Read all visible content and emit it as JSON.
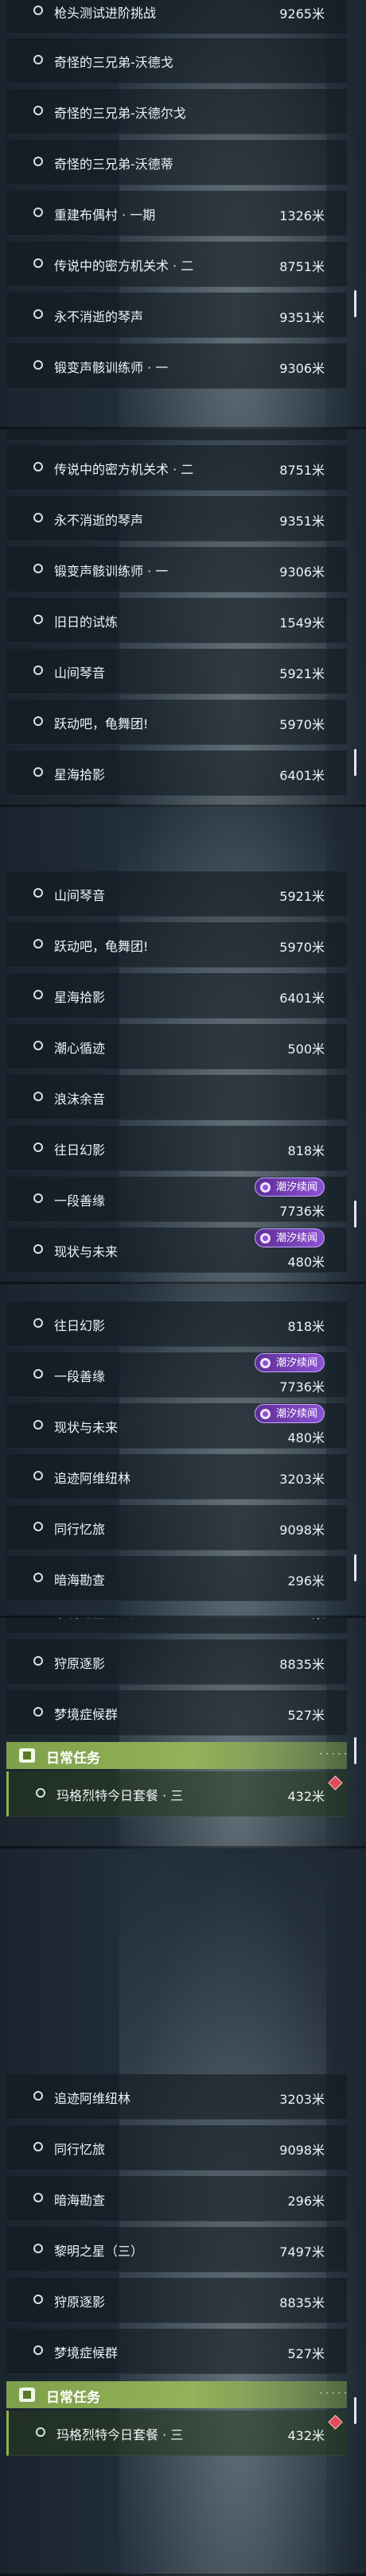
{
  "badge_label": "潮汐续闻",
  "daily": {
    "title": "日常任务",
    "count_dots": "· · · · ·"
  },
  "rows": {
    "r1": {
      "name": "枪头测试进阶挑战",
      "dist": "9265米"
    },
    "r2": {
      "name": "奇怪的三兄弟-沃德戈",
      "dist": ""
    },
    "r3": {
      "name": "奇怪的三兄弟-沃德尔戈",
      "dist": ""
    },
    "r4": {
      "name": "奇怪的三兄弟-沃德蒂",
      "dist": ""
    },
    "r5": {
      "name": "重建布偶村 · 一期",
      "dist": "1326米"
    },
    "r6": {
      "name": "传说中的密方机关术 · 二",
      "dist": "8751米"
    },
    "r7": {
      "name": "永不消逝的琴声",
      "dist": "9351米"
    },
    "r8": {
      "name": "锻变声骸训练师 · 一",
      "dist": "9306米"
    },
    "r9": {
      "name": "旧日的试炼",
      "dist": "1549米"
    },
    "r10": {
      "name": "山间琴音",
      "dist": "5921米"
    },
    "r11": {
      "name": "跃动吧，龟舞团!",
      "dist": "5970米"
    },
    "r12": {
      "name": "星海拾影",
      "dist": "6401米"
    },
    "r13": {
      "name": "潮心循迹",
      "dist": "500米"
    },
    "r14": {
      "name": "浪沫余音",
      "dist": ""
    },
    "r15": {
      "name": "往日幻影",
      "dist": "818米"
    },
    "r16": {
      "name": "一段善缘",
      "dist": "7736米"
    },
    "r17": {
      "name": "现状与未来",
      "dist": "480米"
    },
    "r18": {
      "name": "追迹阿维纽林",
      "dist": "3203米"
    },
    "r19": {
      "name": "同行忆旅",
      "dist": "9098米"
    },
    "r20": {
      "name": "暗海勘查",
      "dist": "296米"
    },
    "r21": {
      "name": "黎明之星（三）",
      "dist": "7497米"
    },
    "r22": {
      "name": "狩原逐影",
      "dist": "8835米"
    },
    "r23": {
      "name": "梦境症候群",
      "dist": "527米"
    },
    "r24": {
      "name": "玛格烈特今日套餐 · 三",
      "dist": "432米"
    }
  }
}
